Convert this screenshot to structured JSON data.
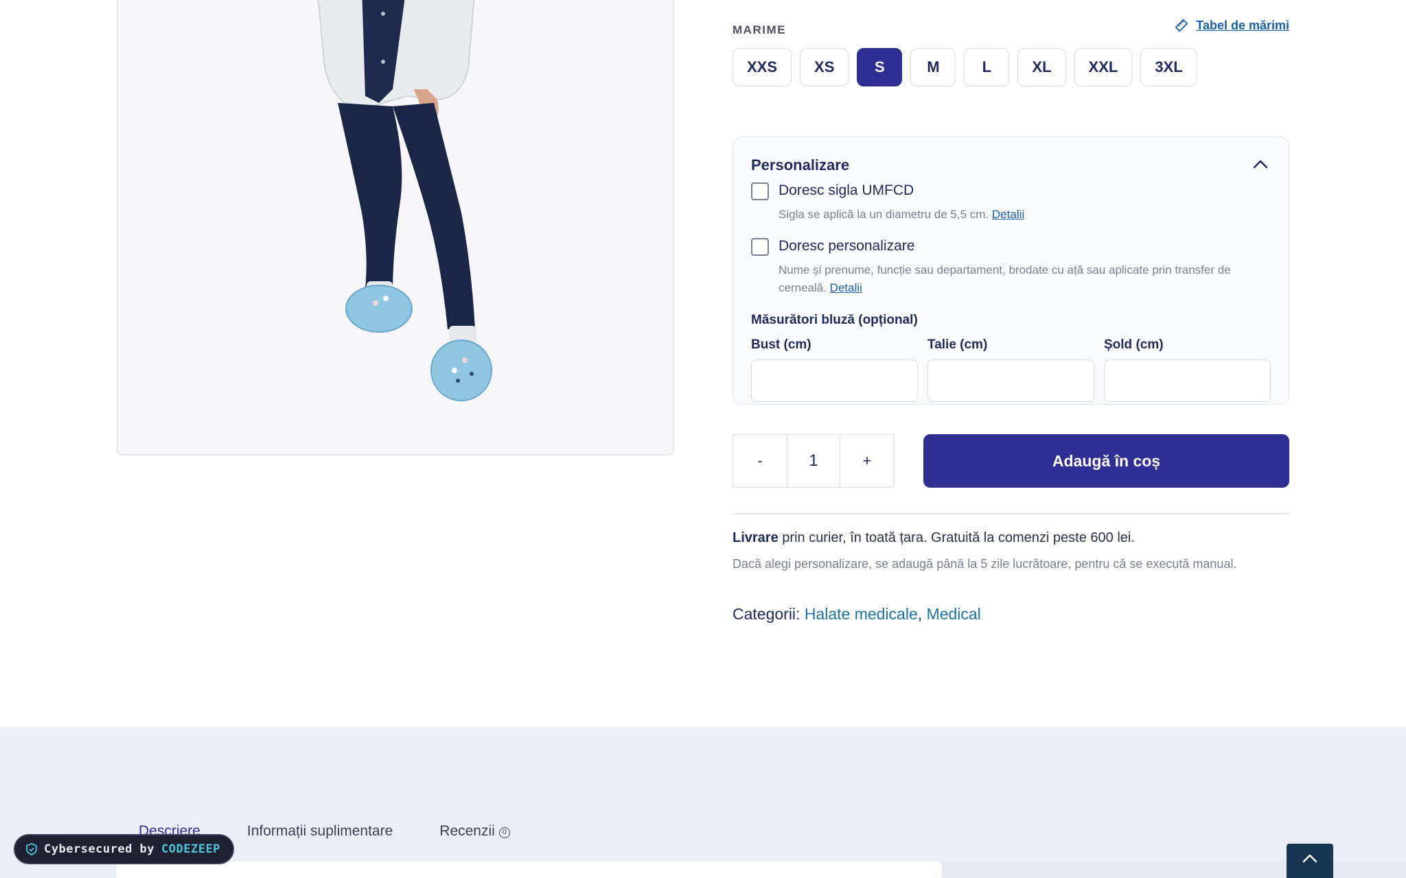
{
  "size_selector": {
    "label": "MARIME",
    "size_chart_link": "Tabel de mărimi",
    "sizes": [
      "XXS",
      "XS",
      "S",
      "M",
      "L",
      "XL",
      "XXL",
      "3XL"
    ],
    "selected": "S"
  },
  "personalization": {
    "title": "Personalizare",
    "options": [
      {
        "title": "Doresc sigla UMFCD",
        "description": "Sigla se aplică la un diametru de 5,5 cm.",
        "link": "Detalii",
        "checked": false
      },
      {
        "title": "Doresc personalizare",
        "description": "Nume și prenume, funcție sau departament, brodate cu ață sau aplicate prin transfer de cerneală.",
        "link": "Detalii",
        "checked": false
      }
    ],
    "measurements": {
      "title": "Măsurători bluză (opțional)",
      "fields": [
        {
          "label": "Bust (cm)",
          "value": ""
        },
        {
          "label": "Talie (cm)",
          "value": ""
        },
        {
          "label": "Șold (cm)",
          "value": ""
        }
      ]
    }
  },
  "purchase": {
    "decrement": "-",
    "quantity": "1",
    "increment": "+",
    "add_to_cart": "Adaugă în coș"
  },
  "delivery": {
    "label": "Livrare",
    "text": "prin curier, în toată țara. Gratuită la comenzi peste 600 lei.",
    "note": "Dacă alegi personalizare, se adaugă până la 5 zile lucrătoare, pentru că se execută manual."
  },
  "categories": {
    "label": "Categorii:",
    "items": [
      "Halate medicale",
      "Medical"
    ],
    "separator": ","
  },
  "tabs": [
    {
      "label": "Descriere",
      "active": true
    },
    {
      "label": "Informații suplimentare",
      "active": false
    },
    {
      "label": "Recenzii",
      "active": false,
      "badge": "0"
    }
  ],
  "security_badge": {
    "prefix": "Cybersecured by",
    "brand": "CODEZEEP"
  },
  "colors": {
    "primary": "#2e2e93",
    "link": "#1b5fa8",
    "category_link": "#1b74a8",
    "lower_bg": "#eaeef7",
    "security_brand": "#4cc6d8"
  }
}
